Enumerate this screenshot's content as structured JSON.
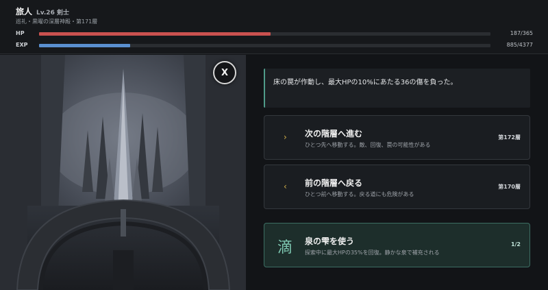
{
  "header": {
    "name": "旅人",
    "level": "Lv.26 剣士",
    "location": "巡礼・黒曜の深層神殿・第171層",
    "hp": {
      "label": "HP",
      "current": 187,
      "max": 365,
      "text": "187/365"
    },
    "exp": {
      "label": "EXP",
      "current": 885,
      "max": 4377,
      "text": "885/4377"
    }
  },
  "scene": {
    "description_icon": "dark-cathedral-illustration",
    "close_label": "X"
  },
  "message": {
    "text": "床の罠が作動し、最大HPの10%にあたる36の傷を負った。"
  },
  "options": [
    {
      "icon": "›",
      "icon_name": "chevron-right-icon",
      "title": "次の階層へ進む",
      "desc": "ひとつ先へ移動する。敵、回復、罠の可能性がある",
      "badge": "第172層"
    },
    {
      "icon": "‹",
      "icon_name": "chevron-left-icon",
      "title": "前の階層へ戻る",
      "desc": "ひとつ前へ移動する。戻る道にも危険がある",
      "badge": "第170層"
    },
    {
      "icon": "滴",
      "icon_name": "drop-kanji-icon",
      "title": "泉の雫を使う",
      "desc": "探索中に最大HPの35%を回復。静かな泉で補充される",
      "badge": "1/2"
    }
  ],
  "colors": {
    "hp_bar": "#c9514f",
    "exp_bar": "#5a8fcf",
    "accent": "#4f9c8a",
    "option_gold": "#d4b24a"
  }
}
